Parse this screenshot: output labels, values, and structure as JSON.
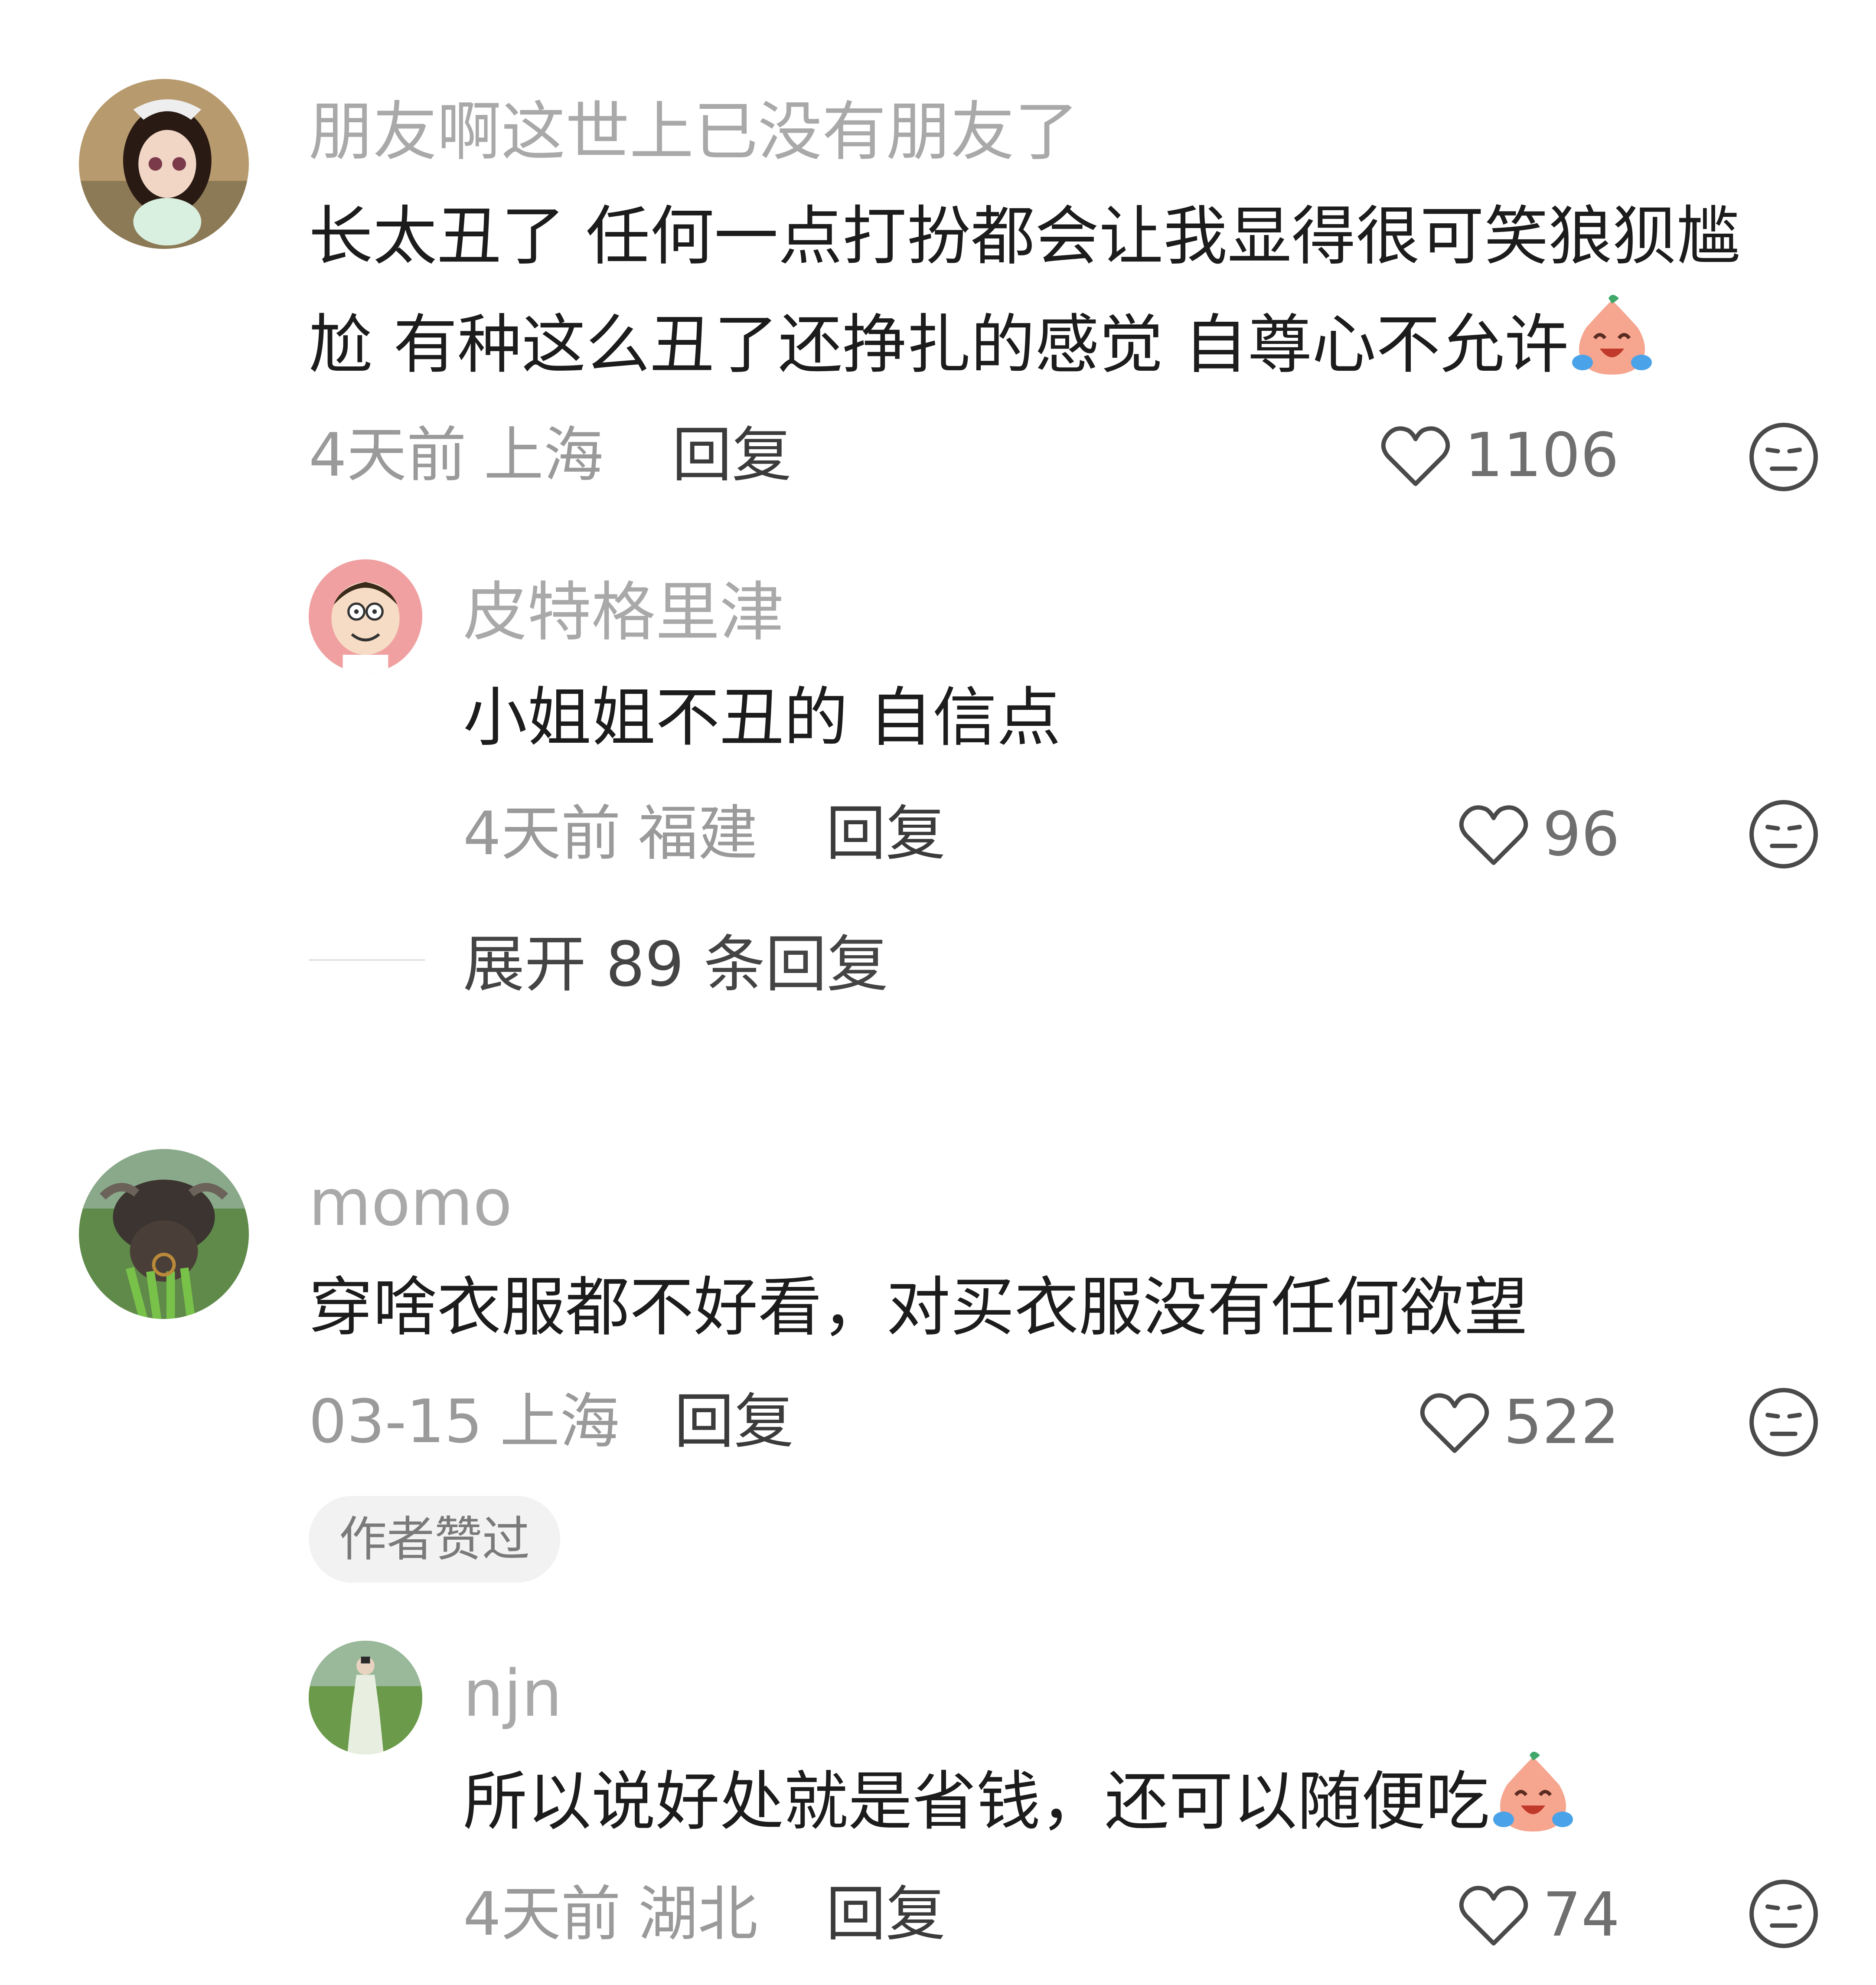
{
  "comments": [
    {
      "username": "朋友啊这世上已没有朋友了",
      "content_line1": "长太丑了 任何一点打扮都会让我显得很可笑狼狈尴",
      "content_line2": "尬 有种这么丑了还挣扎的感觉 自尊心不允许",
      "time": "4天前",
      "location": "上海",
      "reply_label": "回复",
      "likes": "1106",
      "replies": [
        {
          "username": "皮特格里津",
          "content": "小姐姐不丑的 自信点",
          "time": "4天前",
          "location": "福建",
          "reply_label": "回复",
          "likes": "96"
        }
      ],
      "expand_label": "展开 89 条回复"
    },
    {
      "username": "momo",
      "content": "穿啥衣服都不好看，对买衣服没有任何欲望",
      "time": "03-15",
      "location": "上海",
      "reply_label": "回复",
      "likes": "522",
      "author_badge": "作者赞过",
      "replies": [
        {
          "username": "njn",
          "content": "所以说好处就是省钱，还可以随便吃",
          "time": "4天前",
          "location": "湖北",
          "reply_label": "回复",
          "likes": "74"
        }
      ]
    }
  ],
  "icons": {
    "like": "heart-outline-icon",
    "dislike": "neutral-face-icon",
    "emoji": "crying-laughing-sticker"
  },
  "colors": {
    "username": "#a9a9a9",
    "content": "#1c1c1c",
    "meta": "#9a9a9a",
    "badge_bg": "#f2f2f2"
  }
}
